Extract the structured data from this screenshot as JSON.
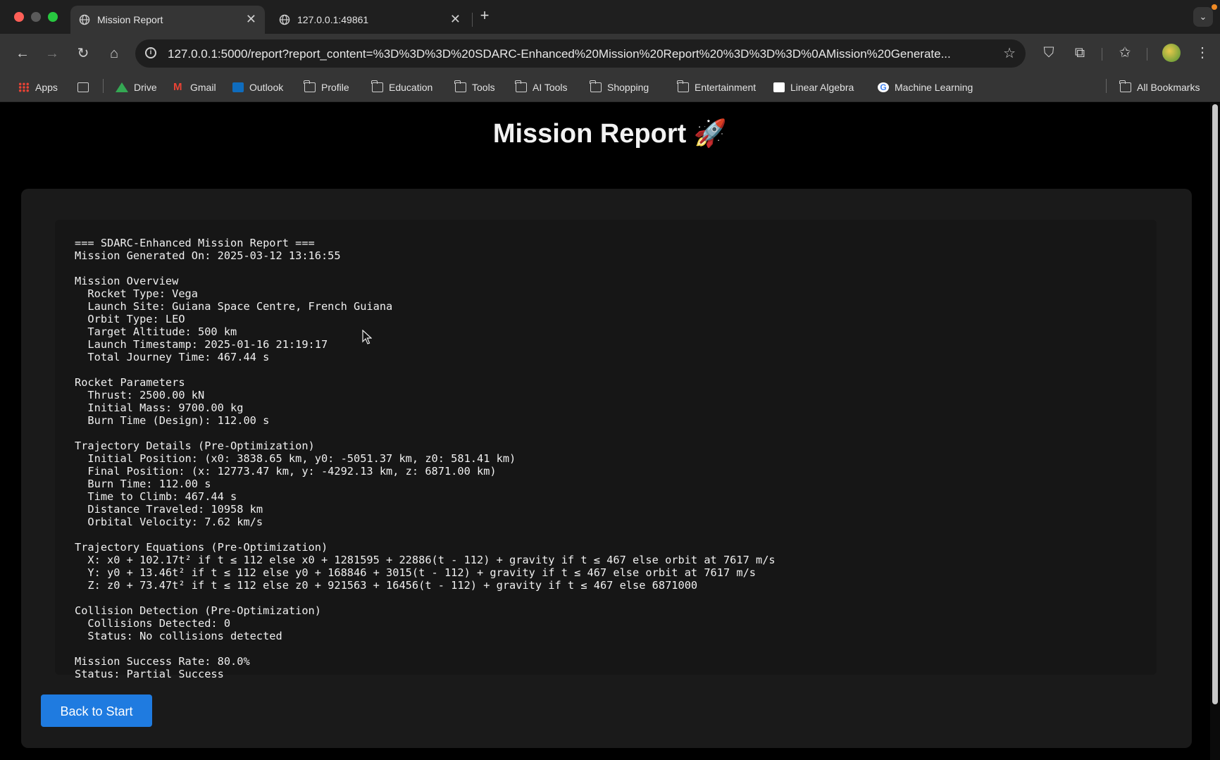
{
  "tabs": [
    {
      "title": "Mission Report",
      "active": true
    },
    {
      "title": "127.0.0.1:49861",
      "active": false
    }
  ],
  "toolbar": {
    "url": "127.0.0.1:5000/report?report_content=%3D%3D%3D%20SDARC-Enhanced%20Mission%20Report%20%3D%3D%3D%0AMission%20Generate..."
  },
  "bookmarks": {
    "apps": "Apps",
    "drive": "Drive",
    "gmail": "Gmail",
    "outlook": "Outlook",
    "profile": "Profile",
    "education": "Education",
    "tools": "Tools",
    "ai_tools": "AI Tools",
    "shopping": "Shopping",
    "entertainment": "Entertainment",
    "linear_algebra": "Linear Algebra",
    "machine_learning": "Machine Learning",
    "all_bookmarks": "All Bookmarks"
  },
  "page": {
    "title": "Mission Report 🚀",
    "report_text": "=== SDARC-Enhanced Mission Report ===\nMission Generated On: 2025-03-12 13:16:55\n\nMission Overview\n  Rocket Type: Vega\n  Launch Site: Guiana Space Centre, French Guiana\n  Orbit Type: LEO\n  Target Altitude: 500 km\n  Launch Timestamp: 2025-01-16 21:19:17\n  Total Journey Time: 467.44 s\n\nRocket Parameters\n  Thrust: 2500.00 kN\n  Initial Mass: 9700.00 kg\n  Burn Time (Design): 112.00 s\n\nTrajectory Details (Pre-Optimization)\n  Initial Position: (x0: 3838.65 km, y0: -5051.37 km, z0: 581.41 km)\n  Final Position: (x: 12773.47 km, y: -4292.13 km, z: 6871.00 km)\n  Burn Time: 112.00 s\n  Time to Climb: 467.44 s\n  Distance Traveled: 10958 km\n  Orbital Velocity: 7.62 km/s\n\nTrajectory Equations (Pre-Optimization)\n  X: x0 + 102.17t² if t ≤ 112 else x0 + 1281595 + 22886(t - 112) + gravity if t ≤ 467 else orbit at 7617 m/s\n  Y: y0 + 13.46t² if t ≤ 112 else y0 + 168846 + 3015(t - 112) + gravity if t ≤ 467 else orbit at 7617 m/s\n  Z: z0 + 73.47t² if t ≤ 112 else z0 + 921563 + 16456(t - 112) + gravity if t ≤ 467 else 6871000\n\nCollision Detection (Pre-Optimization)\n  Collisions Detected: 0\n  Status: No collisions detected\n\nMission Success Rate: 80.0%\nStatus: Partial Success",
    "back_button": "Back to Start"
  },
  "colors": {
    "accent_button": "#1f7be0",
    "page_bg": "#000000",
    "card_bg": "#1a1a1a"
  },
  "icons": [
    "globe-icon",
    "close-icon",
    "plus-icon",
    "back-arrow-icon",
    "forward-arrow-icon",
    "reload-icon",
    "home-icon",
    "site-info-icon",
    "star-icon",
    "shield-icon",
    "extensions-icon",
    "bookmarks-icon",
    "kebab-menu-icon",
    "folder-icon",
    "cursor-icon"
  ]
}
